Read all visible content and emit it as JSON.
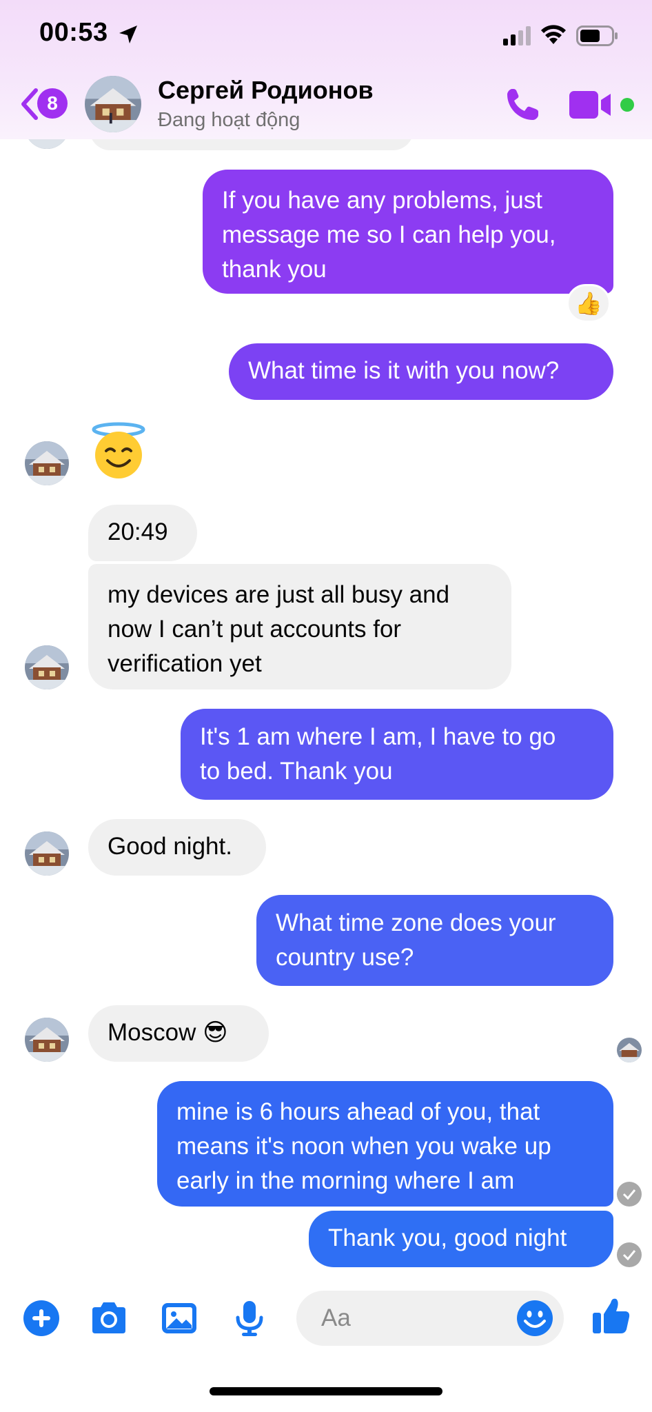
{
  "status_bar": {
    "time": "00:53"
  },
  "header": {
    "back_badge": "8",
    "contact_name": "Сергей Родионов",
    "contact_status": "Đang hoạt động"
  },
  "messages": [
    {
      "dir": "out",
      "text_lines": [
        "If you have any problems, just",
        "message me so I can help you,",
        "thank you"
      ],
      "reaction": "👍"
    },
    {
      "dir": "out",
      "text_lines": [
        "What time is it with you now?"
      ]
    },
    {
      "dir": "in",
      "emoji": "😇"
    },
    {
      "dir": "in",
      "text_lines": [
        "20:49"
      ]
    },
    {
      "dir": "in",
      "text_lines": [
        "my devices are just all busy and",
        "now I can’t put accounts for",
        "verification yet"
      ]
    },
    {
      "dir": "out",
      "text_lines": [
        "It's 1 am where I am, I have to go",
        "to bed.  Thank you"
      ]
    },
    {
      "dir": "in",
      "text_lines": [
        "Good night."
      ]
    },
    {
      "dir": "out",
      "text_lines": [
        "What time zone does your",
        "country use?"
      ]
    },
    {
      "dir": "in",
      "text_lines": [
        "Moscow 😎"
      ]
    },
    {
      "dir": "out",
      "text_lines": [
        "mine is 6 hours ahead of you, that",
        "means it's noon when you wake up",
        "early in the morning where I am"
      ]
    },
    {
      "dir": "out",
      "text_lines": [
        "Thank you, good night"
      ]
    }
  ],
  "composer": {
    "placeholder": "Aa"
  },
  "colors": {
    "accent": "#a030f0",
    "bubble_purple": "#8c3cf2",
    "bubble_violet": "#6a4cf4",
    "bubble_blue": "#4a62f4",
    "bubble_deep_blue": "#2f6ff4",
    "composer_blue": "#1877f2",
    "incoming_bubble": "#f0f0f0"
  },
  "icons": [
    "back-chevron-icon",
    "phone-icon",
    "video-camera-icon",
    "plus-icon",
    "camera-icon",
    "gallery-icon",
    "microphone-icon",
    "emoji-icon",
    "thumbs-up-icon"
  ]
}
